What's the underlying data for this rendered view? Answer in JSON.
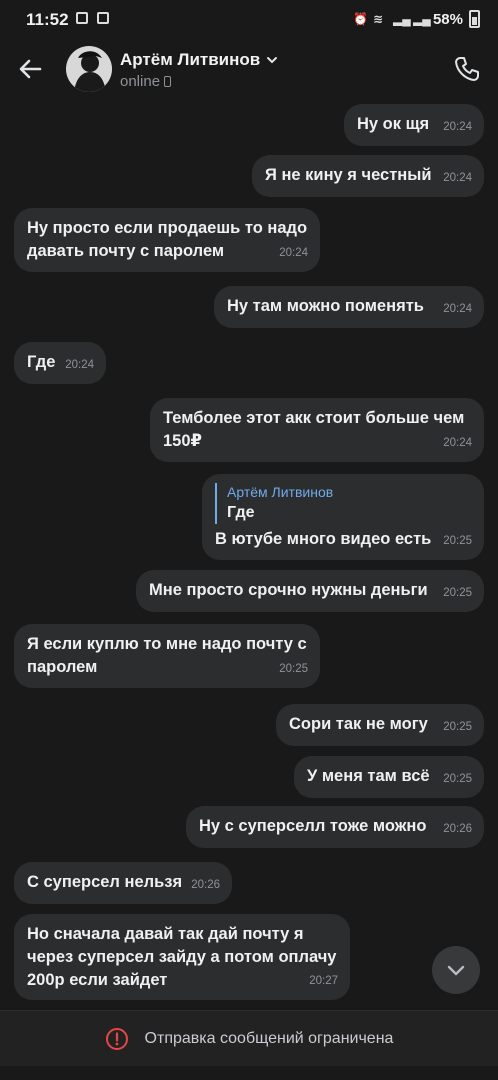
{
  "statusbar": {
    "time": "11:52",
    "battery": "58%"
  },
  "header": {
    "name": "Артём Литвинов",
    "status": "online"
  },
  "messages": [
    {
      "text": "Ну ок щя",
      "time": "20:24",
      "dir": "out"
    },
    {
      "text": "Я не кину я честный",
      "time": "20:24",
      "dir": "out"
    },
    {
      "text": "Ну просто если продаешь то надо давать почту с паролем",
      "time": "20:24",
      "dir": "in"
    },
    {
      "text": "Ну там можно поменять",
      "time": "20:24",
      "dir": "out"
    },
    {
      "text": "Где",
      "time": "20:24",
      "dir": "in"
    },
    {
      "text": "Темболее этот акк стоит больше чем 150₽",
      "time": "20:24",
      "dir": "out"
    },
    {
      "reply_name": "Артём Литвинов",
      "reply_text": "Где",
      "text": "В ютубе много видео есть",
      "time": "20:25",
      "dir": "out"
    },
    {
      "text": "Мне просто срочно нужны деньги",
      "time": "20:25",
      "dir": "out"
    },
    {
      "text": "Я если куплю то мне надо почту с паролем",
      "time": "20:25",
      "dir": "in"
    },
    {
      "text": "Сори так не могу",
      "time": "20:25",
      "dir": "out"
    },
    {
      "text": "У меня там всё",
      "time": "20:25",
      "dir": "out"
    },
    {
      "text": "Ну с суперселл тоже можно",
      "time": "20:26",
      "dir": "out"
    },
    {
      "text": "С суперсел нельзя",
      "time": "20:26",
      "dir": "in"
    },
    {
      "text": "Но сначала давай так дай почту я через суперсел зайду а потом оплачу 200р если зайдет",
      "time": "20:27",
      "dir": "in"
    }
  ],
  "footer": {
    "notice": "Отправка сообщений ограничена"
  },
  "colors": {
    "accent": "#71aaeb",
    "bubble": "#2c2d2e",
    "background": "#19191a",
    "warning": "#e64646"
  }
}
